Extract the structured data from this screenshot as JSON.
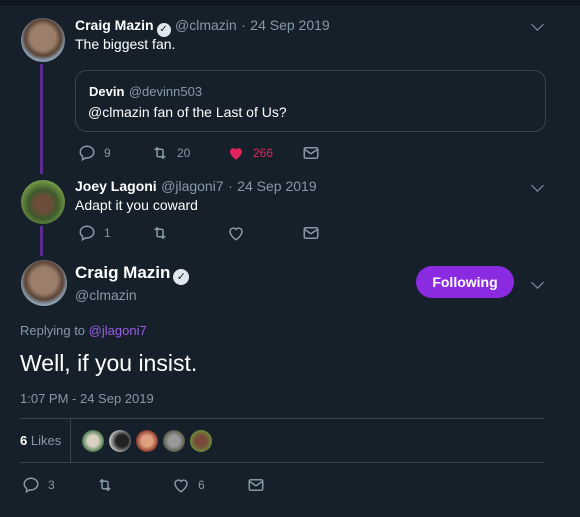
{
  "tweets": [
    {
      "name": "Craig Mazin",
      "verified": true,
      "handle": "@clmazin",
      "sep": "·",
      "date": "24 Sep 2019",
      "text": "The biggest fan.",
      "quote": {
        "name": "Devin",
        "handle": "@devinn503",
        "text": "@clmazin fan of the Last of Us?"
      },
      "actions": {
        "replies": "9",
        "retweets": "20",
        "likes": "266",
        "liked": true
      }
    },
    {
      "name": "Joey Lagoni",
      "verified": false,
      "handle": "@jlagoni7",
      "sep": "·",
      "date": "24 Sep 2019",
      "text": "Adapt it you coward",
      "actions": {
        "replies": "1",
        "retweets": "",
        "likes": "",
        "liked": false
      }
    }
  ],
  "main": {
    "name": "Craig Mazin",
    "verified": true,
    "handle": "@clmazin",
    "follow_label": "Following",
    "replying_prefix": "Replying to",
    "replying_handle": "@jlagoni7",
    "text": "Well, if you insist.",
    "timestamp": "1:07 PM - 24 Sep 2019",
    "likes_count": "6",
    "likes_label": "Likes",
    "actions": {
      "replies": "3",
      "retweets": "",
      "likes": "6"
    }
  },
  "colors": {
    "background": "#15202b",
    "accent": "#8a2be2",
    "like_red": "#e0245e",
    "muted": "#8899a6",
    "thread_line": "#5c2d91",
    "link": "#9b5de5"
  },
  "icons": [
    "reply-icon",
    "retweet-icon",
    "heart-icon",
    "envelope-icon",
    "chevron-down-icon",
    "verified-badge-icon"
  ]
}
